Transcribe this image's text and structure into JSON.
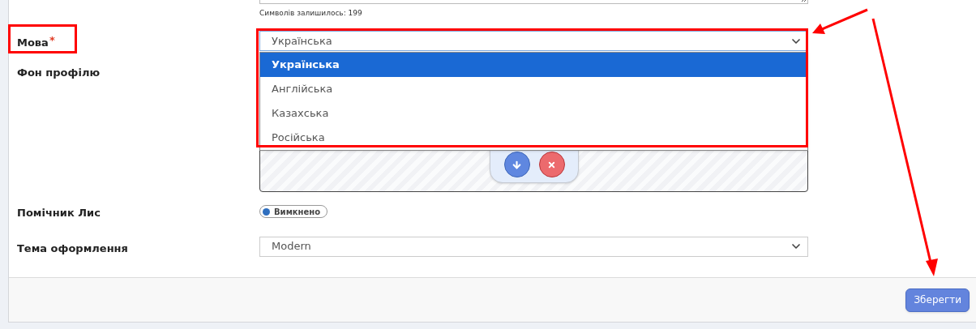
{
  "char_counter": "Символів залишилось: 199",
  "fields": [
    {
      "kind": "select",
      "label": "Мова",
      "required_mark": "*",
      "value": "Українська",
      "expanded": true,
      "options": [
        {
          "label": "Українська",
          "selected": true
        },
        {
          "label": "Англійська",
          "selected": false
        },
        {
          "label": "Казахська",
          "selected": false
        },
        {
          "label": "Російська",
          "selected": false
        }
      ]
    },
    {
      "kind": "image",
      "label": "Фон профілю"
    },
    {
      "kind": "toggle",
      "label": "Помічник Лис",
      "on": false,
      "state_text": "Вимкнено"
    },
    {
      "kind": "select",
      "label": "Тема оформлення",
      "value": "Modern",
      "expanded": false
    }
  ],
  "save_button": "Зберегти"
}
